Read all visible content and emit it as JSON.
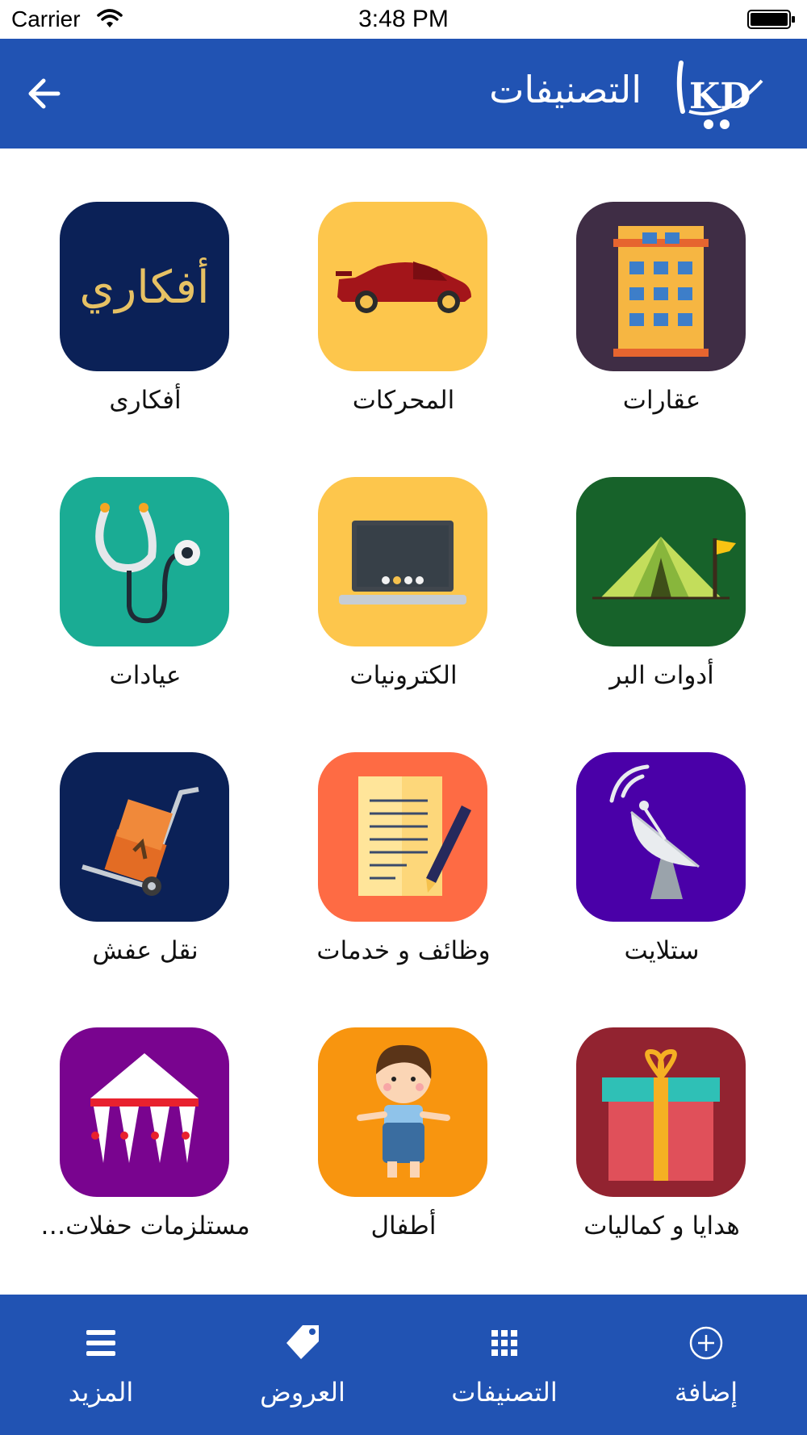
{
  "status_bar": {
    "carrier": "Carrier",
    "time": "3:48 PM"
  },
  "header": {
    "title": "التصنيفات",
    "logo_text": "KD"
  },
  "categories": [
    {
      "label": "عقارات",
      "icon": "building-icon",
      "bg": "#3f2d45"
    },
    {
      "label": "المحركات",
      "icon": "sports-car-icon",
      "bg": "#fdc64c"
    },
    {
      "label": "أفكارى",
      "icon": "afkari-logo",
      "bg": "#0b2157",
      "icon_text": "أفكاري"
    },
    {
      "label": "أدوات البر",
      "icon": "tent-icon",
      "bg": "#17622a"
    },
    {
      "label": "الكترونيات",
      "icon": "laptop-icon",
      "bg": "#fdc64c"
    },
    {
      "label": "عيادات",
      "icon": "stethoscope-icon",
      "bg": "#1aac94"
    },
    {
      "label": "ستلايت",
      "icon": "satellite-dish-icon",
      "bg": "#4a00a8"
    },
    {
      "label": "وظائف و خدمات",
      "icon": "document-pen-icon",
      "bg": "#fe6b44"
    },
    {
      "label": "نقل عفش",
      "icon": "hand-truck-icon",
      "bg": "#0b2157"
    },
    {
      "label": "هدايا و كماليات",
      "icon": "gift-icon",
      "bg": "#922330"
    },
    {
      "label": "أطفال",
      "icon": "child-icon",
      "bg": "#f8950f"
    },
    {
      "label": "مستلزمات حفلات…",
      "icon": "party-tent-icon",
      "bg": "#79048f"
    }
  ],
  "tabbar": {
    "tabs": [
      {
        "label": "إضافة",
        "icon": "add-circle-icon"
      },
      {
        "label": "التصنيفات",
        "icon": "grid-icon"
      },
      {
        "label": "العروض",
        "icon": "tag-icon"
      },
      {
        "label": "المزيد",
        "icon": "menu-icon"
      }
    ]
  },
  "colors": {
    "primary": "#2153b3",
    "background": "#ffffff"
  }
}
